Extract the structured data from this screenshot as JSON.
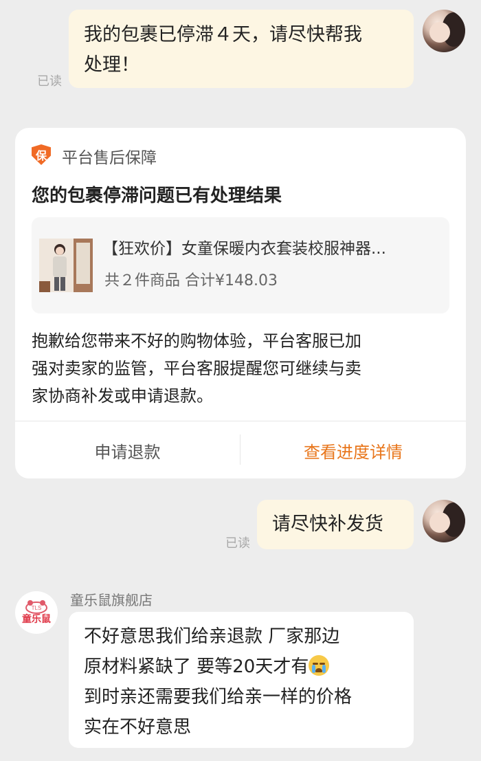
{
  "messages": {
    "out1": {
      "text_line1": "我的包裹已停滞４天，请尽快帮我",
      "text_line2": "处理！",
      "status": "已读"
    },
    "card": {
      "header": "平台售后保障",
      "badge_char": "保",
      "title": "您的包裹停滞问题已有处理结果",
      "product": {
        "name": "【狂欢价】女童保暖内衣套装校服神器...",
        "meta": "共２件商品 合计¥148.03"
      },
      "body_lines": [
        "抱歉给您带来不好的购物体验，平台客服已加",
        "强对卖家的监管，平台客服提醒您可继续与卖",
        "家协商补发或申请退款。"
      ],
      "btn_refund": "申请退款",
      "btn_progress": "查看进度详情"
    },
    "out2": {
      "text": "请尽快补发货",
      "status": "已读"
    },
    "in1": {
      "shop_name": "童乐鼠旗舰店",
      "shop_logo_text": "童乐鼠",
      "shop_logo_small": "TLS",
      "lines": [
        "不好意思我们给亲退款 厂家那边",
        "原材料紧缺了 要等20天才有",
        "到时亲还需要我们给亲一样的价格",
        "实在不好意思"
      ]
    }
  },
  "colors": {
    "accent": "#e8751a",
    "shield": "#f06a25",
    "bubble_out": "#fdf6e3",
    "background": "#ededed"
  },
  "icons": [
    "avatar-self",
    "shield-icon",
    "product-thumbnail",
    "shop-avatar",
    "crying-emoji"
  ]
}
